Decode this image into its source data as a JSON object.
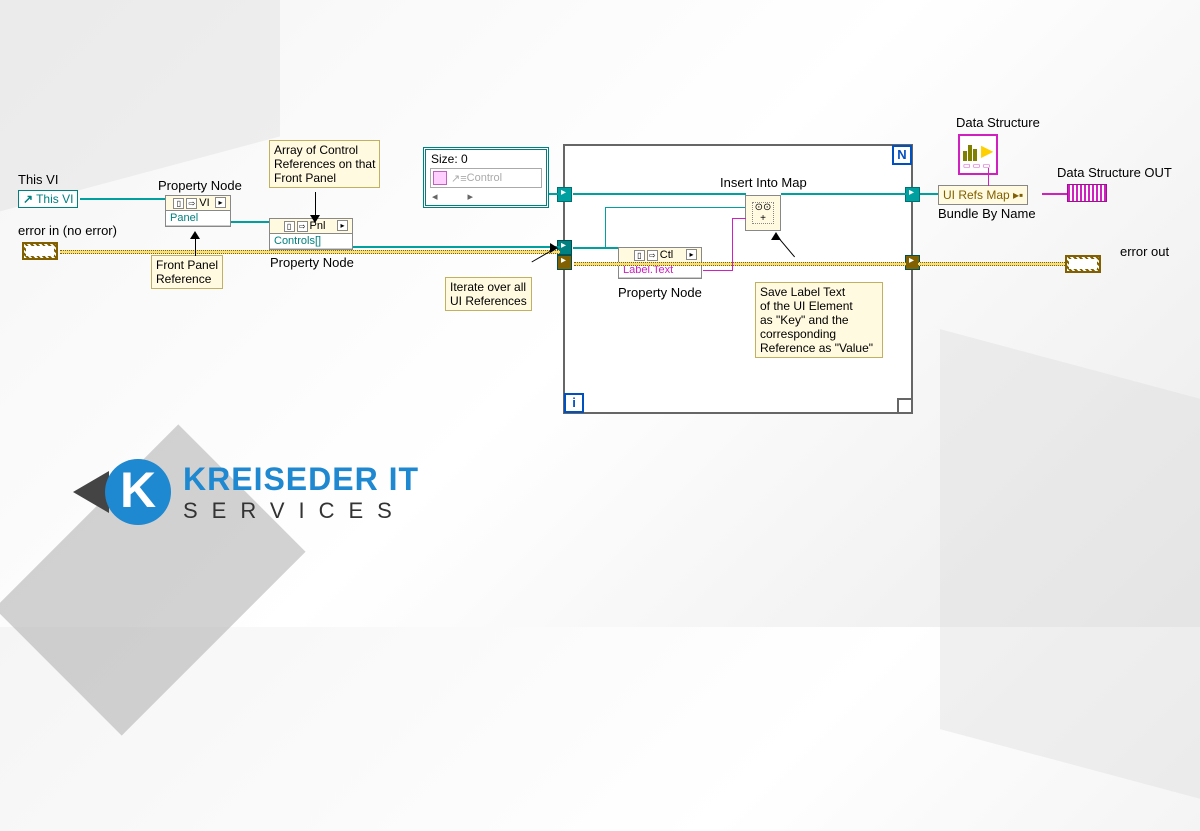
{
  "labels": {
    "this_vi_label": "This VI",
    "this_vi_text": "This VI",
    "error_in": "error in (no error)",
    "error_out": "error out",
    "property_node_1": "Property Node",
    "property_node_2": "Property Node",
    "property_node_3": "Property Node",
    "front_panel_ref": "Front Panel\nReference",
    "array_ctrl_refs": "Array of Control\nReferences on that\nFront Panel",
    "iterate_refs": "Iterate over all\nUI References",
    "insert_map": "Insert Into Map",
    "save_label": "Save Label Text\nof the UI Element\nas \"Key\" and the\ncorresponding\nReference as \"Value\"",
    "bundle_by_name": "Bundle By Name",
    "data_structure": "Data Structure",
    "data_structure_out": "Data Structure OUT",
    "size_0": "Size: 0",
    "control_placeholder": "Control"
  },
  "nodes": {
    "vi": {
      "header": "VI",
      "row": "Panel"
    },
    "pnl": {
      "header": "Pnl",
      "row": "Controls[]"
    },
    "ctl": {
      "header": "Ctl",
      "row": "Label.Text"
    },
    "bundle_field": "UI Refs Map",
    "insert_map_sym": {
      "top": "⊙⊙",
      "mid": "+"
    }
  },
  "loop": {
    "n": "N",
    "i": "i"
  },
  "logo": {
    "main": "KREISEDER IT",
    "sub": "SERVICES",
    "k": "K"
  }
}
